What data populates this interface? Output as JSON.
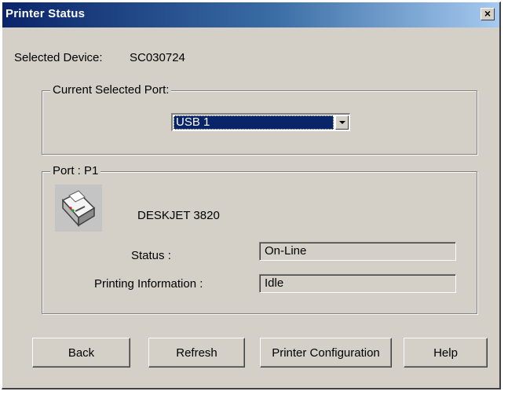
{
  "window": {
    "title": "Printer Status",
    "close_glyph": "✕"
  },
  "device": {
    "label": "Selected Device:",
    "value": "SC030724"
  },
  "port_group": {
    "legend": "Current Selected Port:",
    "selected_port": "USB 1"
  },
  "printer_group": {
    "legend": "Port : P1",
    "icon": "printer-icon",
    "model": "DESKJET 3820",
    "status_label": "Status :",
    "status_value": "On-Line",
    "printing_info_label": "Printing Information :",
    "printing_info_value": "Idle"
  },
  "buttons": {
    "back": "Back",
    "refresh": "Refresh",
    "printer_configuration": "Printer Configuration",
    "help": "Help"
  },
  "colors": {
    "titlebar_start": "#0a246a",
    "titlebar_end": "#a6caf0",
    "dialog_face": "#d4d0c8",
    "selection": "#0a246a"
  }
}
